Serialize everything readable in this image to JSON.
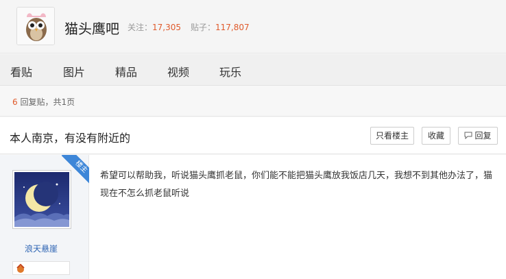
{
  "forum": {
    "name": "猫头鹰吧",
    "follow_label": "关注：",
    "follow_count": "17,305",
    "posts_label": "贴子：",
    "posts_count": "117,807"
  },
  "nav": {
    "items": [
      {
        "label": "看贴"
      },
      {
        "label": "图片"
      },
      {
        "label": "精品"
      },
      {
        "label": "视频"
      },
      {
        "label": "玩乐"
      }
    ]
  },
  "reply_info": {
    "count": "6",
    "text": " 回复贴，共1页"
  },
  "thread": {
    "title": "本人南京，有没有附近的",
    "only_owner_label": "只看楼主",
    "favorite_label": "收藏",
    "reply_label": "回复"
  },
  "post": {
    "author": "浪天悬崖",
    "corner_tag": "楼主",
    "content": "希望可以帮助我，听说猫头鹰抓老鼠，你们能不能把猫头鹰放我饭店几天，我想不到其他办法了，猫现在不怎么抓老鼠听说"
  },
  "colors": {
    "accent_orange": "#e05a2b",
    "link_blue": "#2d64b3",
    "tag_blue": "#3d86d8"
  }
}
